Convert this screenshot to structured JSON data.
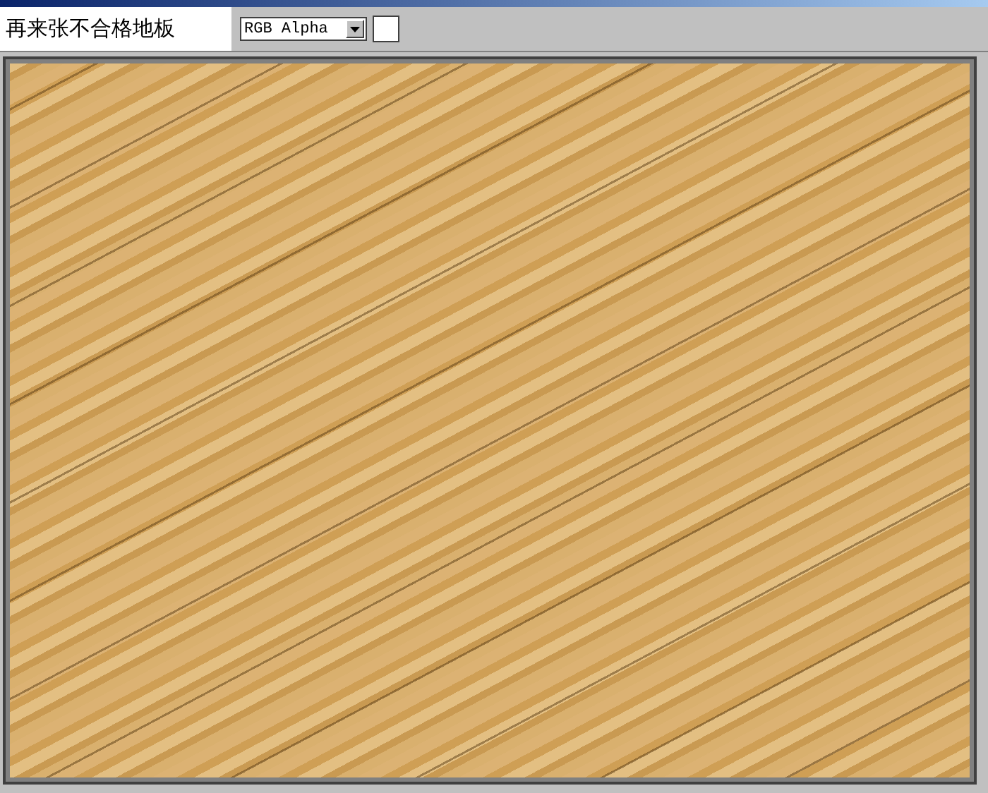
{
  "caption": "再来张不合格地板",
  "toolbar": {
    "channel": "RGB Alpha"
  }
}
